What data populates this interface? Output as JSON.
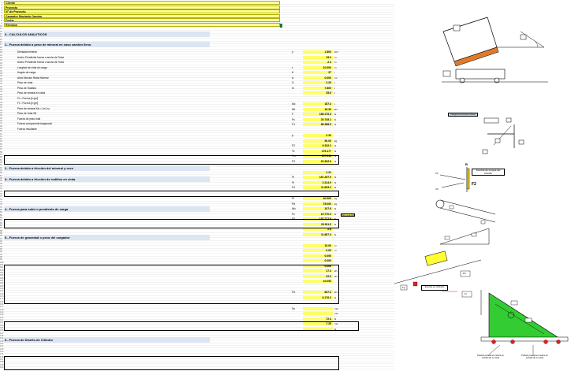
{
  "header_cells": [
    {
      "text": "Cliente"
    },
    {
      "text": "Proyecto"
    },
    {
      "text": "N° de Proyecto"
    },
    {
      "text": "Cargador Montado Camion"
    },
    {
      "text": "Fecha"
    },
    {
      "text": "Revision"
    }
  ],
  "sections": [
    {
      "id": "s0",
      "title": "0.- CALCULOS ANALITICOS"
    },
    {
      "id": "s1",
      "title": "1.- Fuerza debido a peso de mineral en caso camión lleno"
    },
    {
      "id": "s2",
      "title": "2.- Fuerza debido a fricción del mineral y roce"
    },
    {
      "id": "s3",
      "title": "3.- Fuerza debido a fricción de rodillos en cinta"
    },
    {
      "id": "s4",
      "title": "4.- Fuerza para subir o pendiente de carga"
    },
    {
      "id": "s5",
      "title": "5.- Fuerza de gravedad o peso del cargador"
    },
    {
      "id": "s6",
      "title": "6.- Fuerza de Diseño de Cilindro"
    }
  ],
  "values": [
    {
      "sym": "γ",
      "val": "1.800",
      "unit": "t/m³"
    },
    {
      "sym": "",
      "val": "15.0",
      "unit": "m"
    },
    {
      "sym": "",
      "val": "2.4",
      "unit": "m"
    },
    {
      "sym": "L",
      "val": "10.000",
      "unit": "m"
    },
    {
      "sym": "θ",
      "val": "37",
      "unit": "°"
    },
    {
      "sym": "A",
      "val": "0.000",
      "unit": "m²"
    },
    {
      "sym": "G",
      "val": "2.20",
      "unit": "t"
    },
    {
      "sym": "m",
      "val": "7.800",
      "unit": "t"
    },
    {
      "sym": "",
      "val": "25.6",
      "unit": "t"
    },
    {
      "sym": "Mc",
      "val": "187.4",
      "unit": "t"
    },
    {
      "sym": "Wt",
      "val": "18.30",
      "unit": "kN"
    },
    {
      "sym": "F",
      "val": "168.176.3",
      "unit": "N"
    },
    {
      "sym": "Fs",
      "val": "20.745.1",
      "unit": "N"
    },
    {
      "sym": "F1",
      "val": "86.288.9",
      "unit": "N"
    },
    {
      "sym": "μ",
      "val": "2.20",
      "unit": ""
    },
    {
      "sym": "",
      "val": "90.00",
      "unit": "kg"
    },
    {
      "sym": "F2",
      "val": "9.332.2",
      "unit": "N"
    },
    {
      "sym": "Tc",
      "val": "176.177",
      "unit": "N"
    },
    {
      "sym": "Trs",
      "val": "157.516",
      "unit": "N"
    },
    {
      "sym": "F3",
      "val": "24.302.6",
      "unit": "N"
    },
    {
      "sym": "",
      "val": "1.21",
      "unit": ""
    },
    {
      "sym": "Ft",
      "val": "187.257.9",
      "unit": "N"
    },
    {
      "sym": "Ft",
      "val": "2.314.9",
      "unit": "N"
    },
    {
      "sym": "F4",
      "val": "11.833.2",
      "unit": "N"
    },
    {
      "sym": "Pi",
      "val": "40.000",
      "unit": "kg"
    },
    {
      "sym": "Pd",
      "val": "78.000",
      "unit": "kg"
    },
    {
      "sym": "Wc",
      "val": "107.6",
      "unit": "N"
    },
    {
      "sym": "Fc",
      "val": "19.770.0",
      "unit": "N"
    },
    {
      "sym": "F5",
      "val": "187.717.9",
      "unit": "N"
    },
    {
      "sym": "",
      "val": "29.911.5",
      "unit": "N"
    },
    {
      "sym": "",
      "val": "2.8",
      "unit": ""
    },
    {
      "sym": "",
      "val": "11.667.4",
      "unit": "N"
    },
    {
      "sym": "",
      "val": "15.00",
      "unit": "m"
    },
    {
      "sym": "",
      "val": "0.00",
      "unit": "m"
    },
    {
      "sym": "",
      "val": "0.050",
      "unit": ""
    },
    {
      "sym": "",
      "val": "0.000",
      "unit": ""
    },
    {
      "sym": "",
      "val": "0.000",
      "unit": ""
    },
    {
      "sym": "",
      "val": "17.4",
      "unit": "kN"
    },
    {
      "sym": "",
      "val": "22.0",
      "unit": "kN"
    },
    {
      "sym": "",
      "val": "10.053",
      "unit": ""
    },
    {
      "sym": "Fd",
      "val": "837.3",
      "unit": "kN"
    },
    {
      "sym": "",
      "val": "8.176.3",
      "unit": "N"
    },
    {
      "sym": "Dc",
      "val": "",
      "unit": "mm"
    },
    {
      "sym": "",
      "val": "",
      "unit": "mm"
    },
    {
      "sym": "",
      "val": "72.4",
      "unit": "N"
    },
    {
      "sym": "",
      "val": "7.25",
      "unit": "mm"
    },
    {
      "sym": "",
      "val": "",
      "unit": "N"
    }
  ],
  "text_lines": [
    "Densidad mineral",
    "Ancho Pendiente fuerza o ancho de Tolva",
    "Ancho Pendiente fuerza o ancho de Tolva",
    "Longitud de cinta de carga",
    "Ángulo de carga",
    "Área Sección Recta Mineral",
    "Peso de cinta",
    "Peso de Rodillos",
    "Peso de mineral en cinta",
    "Ft = Fuerza [t×g×f]",
    "Ft = Fuerza [t×g×f]",
    "Peso de mineral Mc = A×L×γ",
    "Peso de cinta Wt",
    "Fuerza de peso total",
    "Fuerza componente tangencial",
    "Fuerza resultante"
  ],
  "note_badge": "Dato sugerido",
  "diagram_labels": {
    "caption1": "Diagrama Camion Real",
    "caption2": "Fuerza en Cilindro",
    "caption3": "Fuerzas de empuje del Cilindro",
    "f2": "F2",
    "b_label": "B",
    "fb": "Fb",
    "fr": "Fr",
    "fg": "Fg",
    "v1": "V1",
    "v2": "V2",
    "bottom_left": "Presión posada en cuanto en sentido de su carta",
    "bottom_right": "Presión posada en cuanto en sentido de su carta"
  },
  "colors": {
    "header_fill": "#ffff99",
    "section_band": "#dce6f2",
    "value_fill": "#ffff66",
    "truck_bed": "#e07a2a",
    "loader_green": "#33cc33",
    "hopper_yellow": "#ffff33",
    "marker_red": "#e02020",
    "caption_blue": "#c5d9f1"
  }
}
